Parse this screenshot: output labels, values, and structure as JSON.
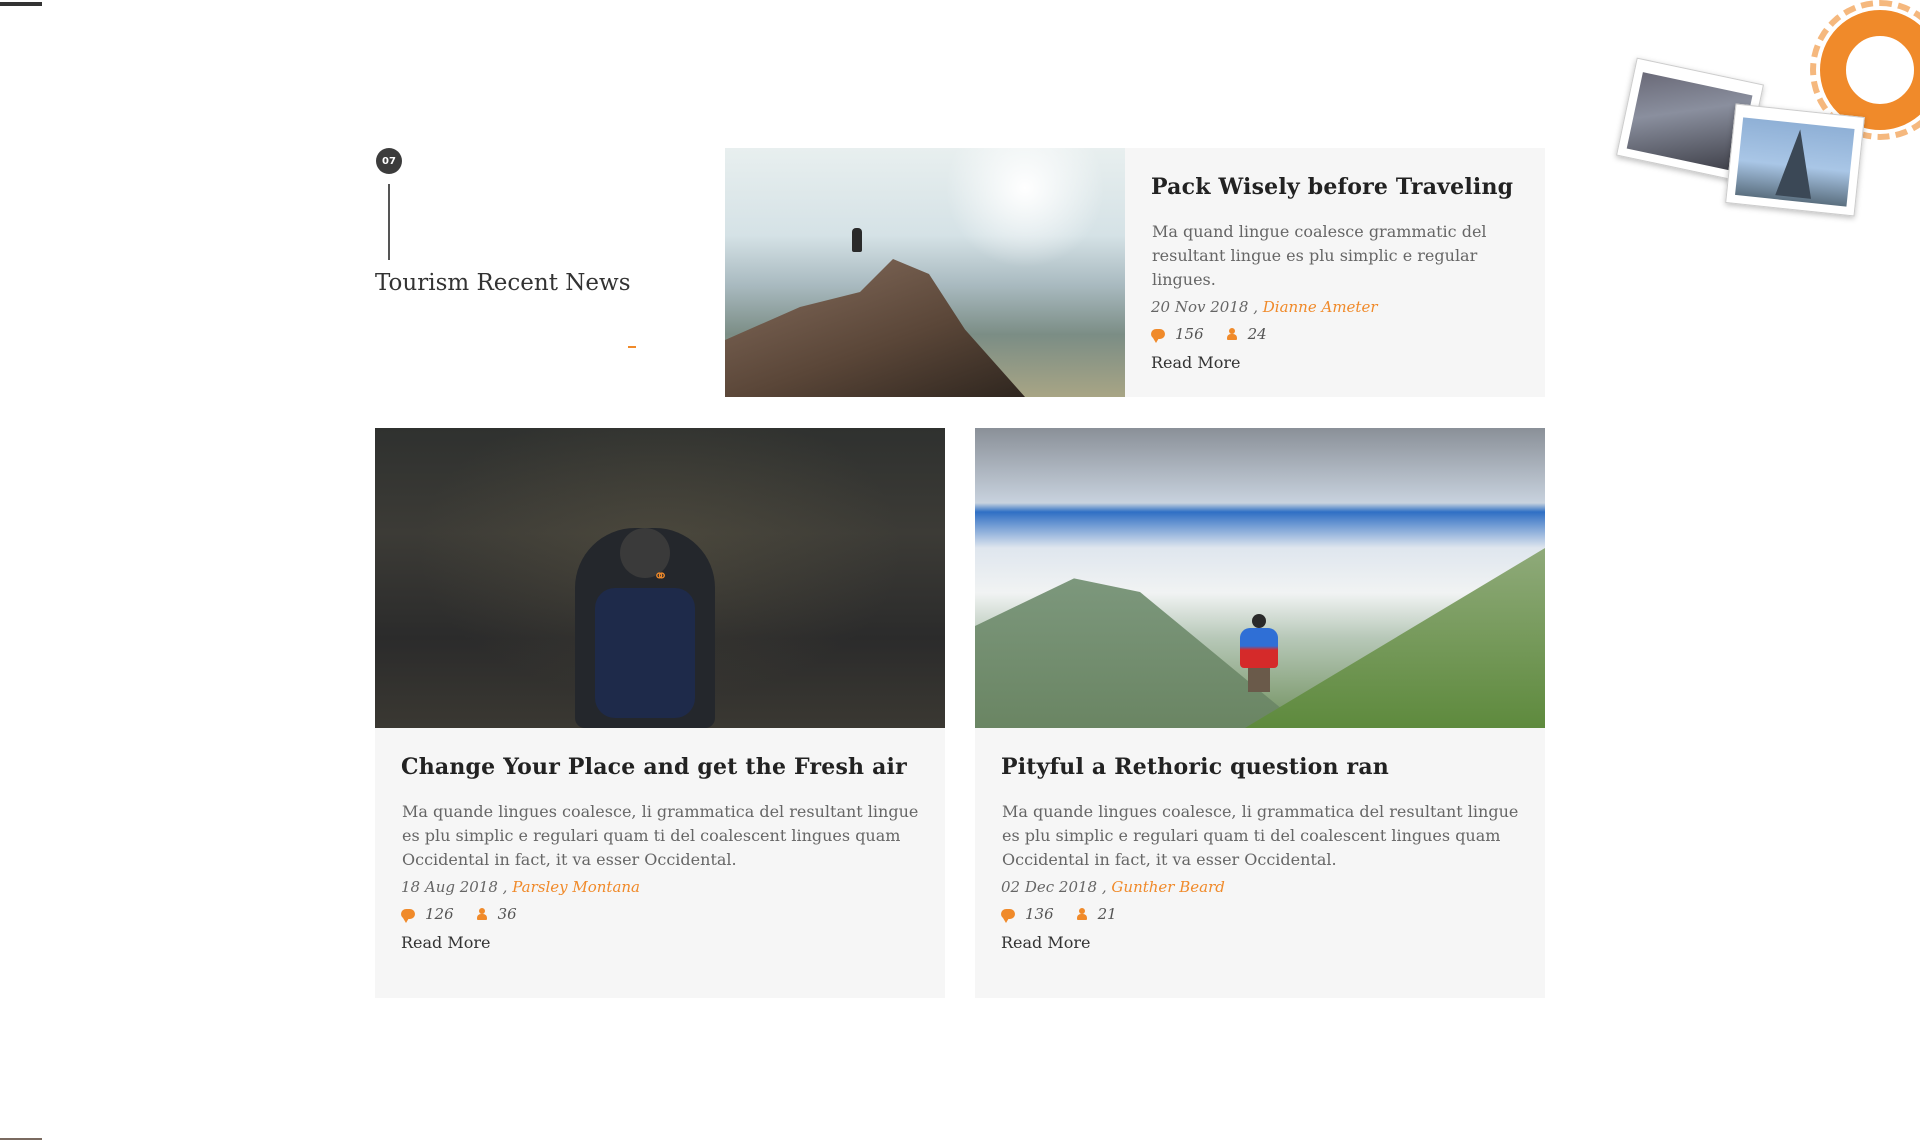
{
  "section": {
    "number": "07",
    "title": "Tourism Recent News"
  },
  "posts": [
    {
      "title": "Pack Wisely before Traveling",
      "excerpt": "Ma quand lingue coalesce grammatic del resultant lingue es plu simplic e regular lingues.",
      "date": "20 Nov 2018 ,",
      "author": "Dianne Ameter",
      "comments": "156",
      "likes": "24",
      "read_more": "Read More",
      "image": "mountain-summit-photo"
    },
    {
      "title": "Change Your Place and get the Fresh air",
      "excerpt": "Ma quande lingues coalesce, li grammatica del resultant lingue es plu simplic e regulari quam ti del coalescent lingues quam Occidental in fact, it va esser Occidental.",
      "date": "18 Aug 2018 ,",
      "author": "Parsley Montana",
      "comments": "126",
      "likes": "36",
      "read_more": "Read More",
      "image": "city-street-backpacker-photo"
    },
    {
      "title": "Pityful a Rethoric question ran",
      "excerpt": "Ma quande lingues coalesce, li grammatica del resultant lingue es plu simplic e regulari quam ti del coalescent lingues quam Occidental in fact, it va esser Occidental.",
      "date": "02 Dec 2018 ,",
      "author": "Gunther Beard",
      "comments": "136",
      "likes": "21",
      "read_more": "Read More",
      "image": "valley-hiker-photo"
    }
  ],
  "icons": {
    "comment": "comment-icon",
    "user": "user-icon",
    "link": "link-icon"
  },
  "colors": {
    "accent": "#f08a2a",
    "card_bg": "#f6f6f6",
    "title": "#222222",
    "text": "#666666"
  }
}
